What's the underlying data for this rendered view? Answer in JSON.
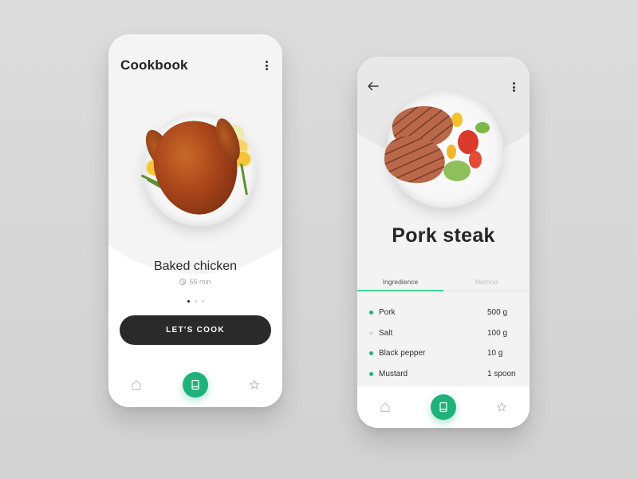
{
  "colors": {
    "accent": "#1fb27b",
    "tab_indicator": "#3fd39a",
    "dark_button": "#2a2a2a",
    "inactive_dot": "#dcdcdc"
  },
  "left_screen": {
    "app_title": "Cookbook",
    "menu_icon": "kebab-vertical-icon",
    "dish": {
      "name": "Baked chicken",
      "time": "55 min",
      "time_icon": "clock-icon",
      "image": "baked-chicken-plate"
    },
    "pager": {
      "count": 3,
      "active_index": 0
    },
    "cta_label": "LET'S COOK",
    "nav": [
      {
        "name": "home",
        "icon": "home-icon",
        "active": false
      },
      {
        "name": "book",
        "icon": "book-icon",
        "active": true
      },
      {
        "name": "favorites",
        "icon": "star-icon",
        "active": false
      }
    ]
  },
  "right_screen": {
    "back_icon": "arrow-left-icon",
    "menu_icon": "kebab-vertical-icon",
    "dish": {
      "name": "Pork steak",
      "image": "pork-steak-salad-plate"
    },
    "tabs": [
      {
        "label": "Ingredience",
        "active": true
      },
      {
        "label": "Method",
        "active": false
      }
    ],
    "ingredients": [
      {
        "name": "Pork",
        "quantity": "500 g",
        "checked": true
      },
      {
        "name": "Salt",
        "quantity": "100 g",
        "checked": false
      },
      {
        "name": "Black pepper",
        "quantity": "10 g",
        "checked": true
      },
      {
        "name": "Mustard",
        "quantity": "1 spoon",
        "checked": true
      }
    ],
    "nav": [
      {
        "name": "home",
        "icon": "home-icon",
        "active": false
      },
      {
        "name": "book",
        "icon": "book-icon",
        "active": true
      },
      {
        "name": "favorites",
        "icon": "star-icon",
        "active": false
      }
    ]
  }
}
